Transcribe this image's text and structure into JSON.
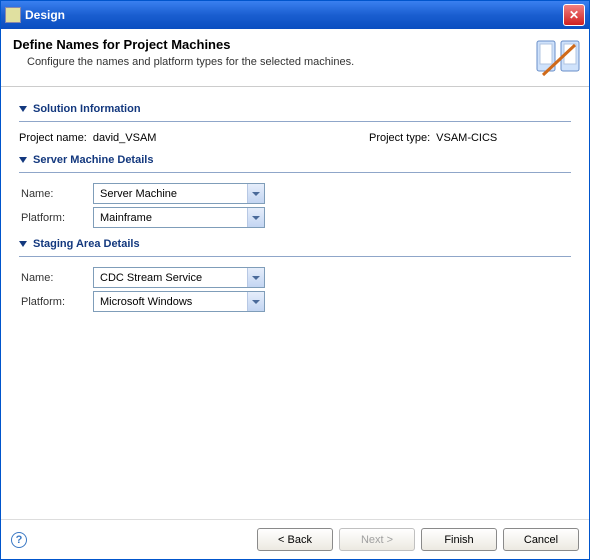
{
  "window": {
    "title": "Design"
  },
  "header": {
    "title": "Define Names for Project Machines",
    "subtitle": "Configure the names and platform types for the selected  machines."
  },
  "sections": {
    "solution": {
      "title": "Solution Information",
      "project_name_label": "Project name:",
      "project_name_value": "david_VSAM",
      "project_type_label": "Project type:",
      "project_type_value": "VSAM-CICS"
    },
    "server": {
      "title": "Server Machine Details",
      "name_label": "Name:",
      "name_value": "Server Machine",
      "platform_label": "Platform:",
      "platform_value": "Mainframe"
    },
    "staging": {
      "title": "Staging Area Details",
      "name_label": "Name:",
      "name_value": "CDC Stream Service",
      "platform_label": "Platform:",
      "platform_value": "Microsoft Windows"
    }
  },
  "buttons": {
    "back": "< Back",
    "next": "Next >",
    "finish": "Finish",
    "cancel": "Cancel"
  }
}
